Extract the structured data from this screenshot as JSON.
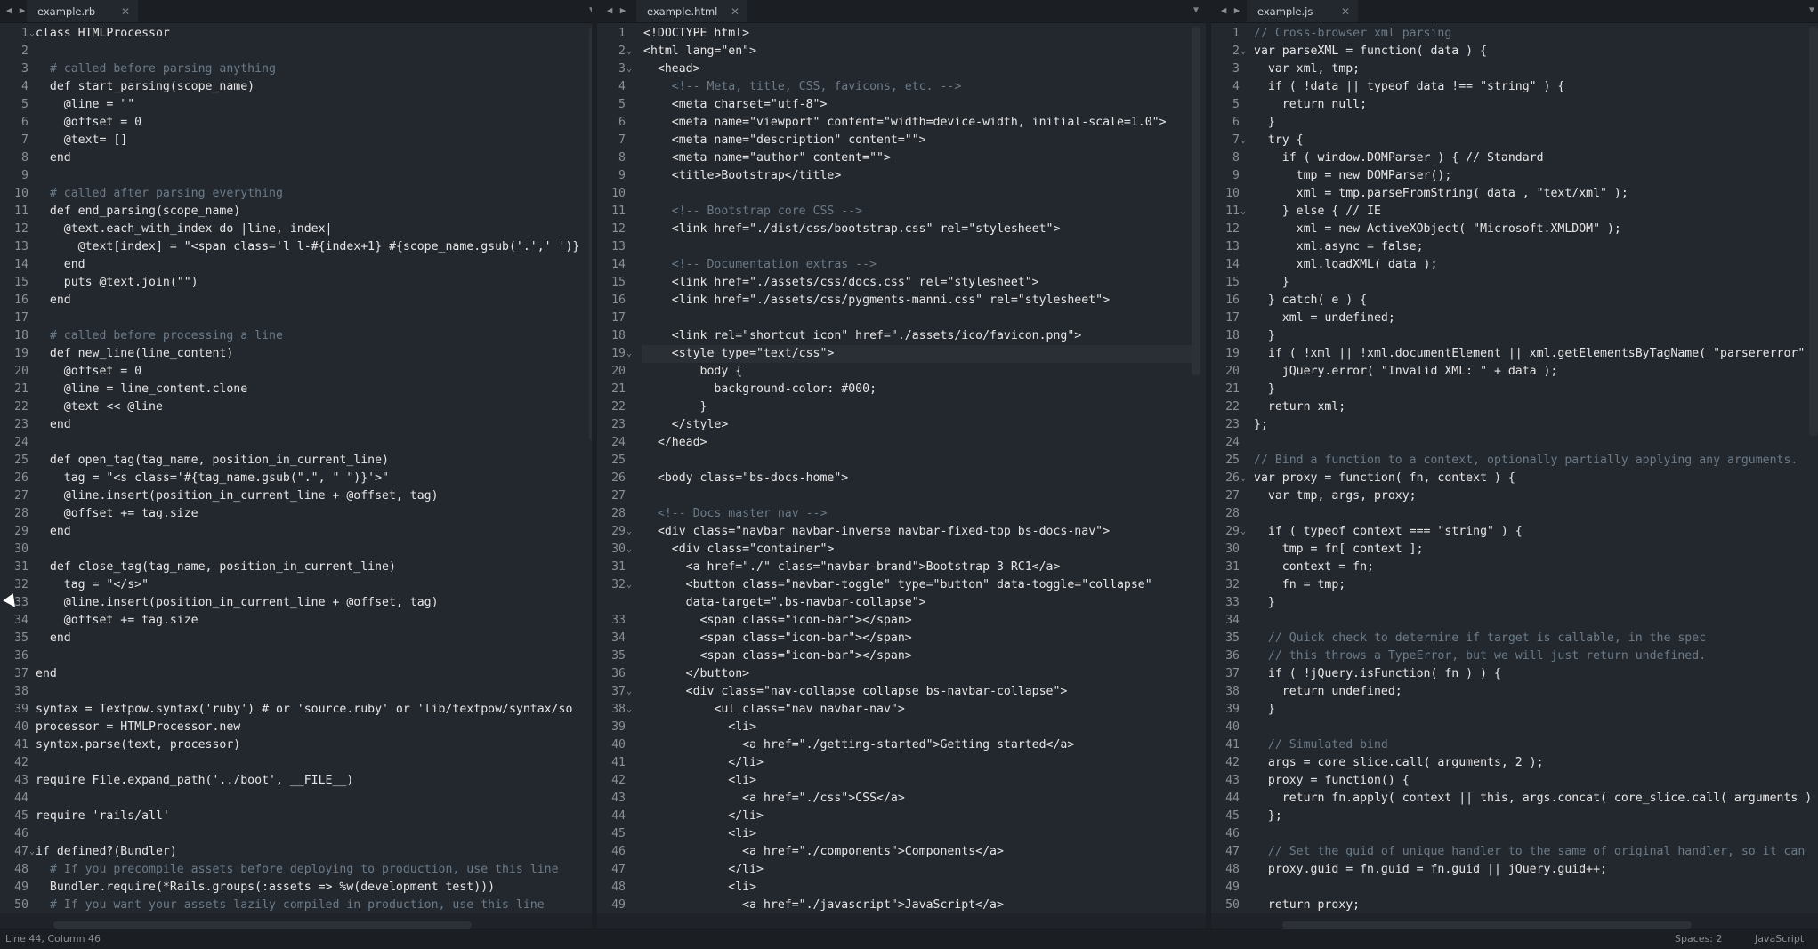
{
  "colors": {
    "bg": "#23272e",
    "accent": "#e27f60",
    "comment": "#6b7b88",
    "string": "#d8d8a8",
    "keyword": "#e27f60",
    "number": "#f2b06b",
    "attr": "#f7d089",
    "fn": "#7ec9d4"
  },
  "panes": [
    {
      "tab": "example.rb"
    },
    {
      "tab": "example.html"
    },
    {
      "tab": "example.js"
    }
  ],
  "status": {
    "position": "Line 44, Column 46",
    "indent": "Spaces: 2",
    "syntax": "JavaScript"
  },
  "pane1": {
    "lines": [
      "class HTMLProcessor",
      "",
      "  # called before parsing anything",
      "  def start_parsing(scope_name)",
      "    @line = \"\"",
      "    @offset = 0",
      "    @text= []",
      "  end",
      "",
      "  # called after parsing everything",
      "  def end_parsing(scope_name)",
      "    @text.each_with_index do |line, index|",
      "      @text[index] = \"<span class='l l-#{index+1} #{scope_name.gsub('.',' ')}",
      "    end",
      "    puts @text.join(\"\")",
      "  end",
      "",
      "  # called before processing a line",
      "  def new_line(line_content)",
      "    @offset = 0",
      "    @line = line_content.clone",
      "    @text << @line",
      "  end",
      "",
      "  def open_tag(tag_name, position_in_current_line)",
      "    tag = \"<s class='#{tag_name.gsub(\".\", \" \")}'>\"",
      "    @line.insert(position_in_current_line + @offset, tag)",
      "    @offset += tag.size",
      "  end",
      "",
      "  def close_tag(tag_name, position_in_current_line)",
      "    tag = \"</s>\"",
      "    @line.insert(position_in_current_line + @offset, tag)",
      "    @offset += tag.size",
      "  end",
      "",
      "end",
      "",
      "syntax = Textpow.syntax('ruby') # or 'source.ruby' or 'lib/textpow/syntax/so",
      "processor = HTMLProcessor.new",
      "syntax.parse(text, processor)",
      "",
      "require File.expand_path('../boot', __FILE__)",
      "",
      "require 'rails/all'",
      "",
      "if defined?(Bundler)",
      "  # If you precompile assets before deploying to production, use this line",
      "  Bundler.require(*Rails.groups(:assets => %w(development test)))",
      "  # If you want your assets lazily compiled in production, use this line"
    ],
    "folds": [
      1,
      47
    ]
  },
  "pane2": {
    "lines": [
      "<!DOCTYPE html>",
      "<html lang=\"en\">",
      "  <head>",
      "    <!-- Meta, title, CSS, favicons, etc. -->",
      "    <meta charset=\"utf-8\">",
      "    <meta name=\"viewport\" content=\"width=device-width, initial-scale=1.0\">",
      "    <meta name=\"description\" content=\"\">",
      "    <meta name=\"author\" content=\"\">",
      "    <title>Bootstrap</title>",
      "",
      "    <!-- Bootstrap core CSS -->",
      "    <link href=\"./dist/css/bootstrap.css\" rel=\"stylesheet\">",
      "",
      "    <!-- Documentation extras -->",
      "    <link href=\"./assets/css/docs.css\" rel=\"stylesheet\">",
      "    <link href=\"./assets/css/pygments-manni.css\" rel=\"stylesheet\">",
      "",
      "    <link rel=\"shortcut icon\" href=\"./assets/ico/favicon.png\">",
      "    <style type=\"text/css\">",
      "        body {",
      "          background-color: #000;",
      "        }",
      "    </style>",
      "  </head>",
      "",
      "  <body class=\"bs-docs-home\">",
      "",
      "  <!-- Docs master nav -->",
      "  <div class=\"navbar navbar-inverse navbar-fixed-top bs-docs-nav\">",
      "    <div class=\"container\">",
      "      <a href=\"./\" class=\"navbar-brand\">Bootstrap 3 RC1</a>",
      "      <button class=\"navbar-toggle\" type=\"button\" data-toggle=\"collapse\"",
      "      data-target=\".bs-navbar-collapse\">",
      "        <span class=\"icon-bar\"></span>",
      "        <span class=\"icon-bar\"></span>",
      "        <span class=\"icon-bar\"></span>",
      "      </button>",
      "      <div class=\"nav-collapse collapse bs-navbar-collapse\">",
      "          <ul class=\"nav navbar-nav\">",
      "            <li>",
      "              <a href=\"./getting-started\">Getting started</a>",
      "            </li>",
      "            <li>",
      "              <a href=\"./css\">CSS</a>",
      "            </li>",
      "            <li>",
      "              <a href=\"./components\">Components</a>",
      "            </li>",
      "            <li>",
      "              <a href=\"./javascript\">JavaScript</a>",
      "            </li>"
    ],
    "numbers": [
      "1",
      "2",
      "3",
      "4",
      "5",
      "6",
      "7",
      "8",
      "9",
      "10",
      "11",
      "12",
      "13",
      "14",
      "15",
      "16",
      "17",
      "18",
      "19",
      "20",
      "21",
      "22",
      "23",
      "24",
      "25",
      "26",
      "27",
      "28",
      "29",
      "30",
      "31",
      "32",
      "",
      "33",
      "34",
      "35",
      "36",
      "37",
      "38",
      "39",
      "40",
      "41",
      "42",
      "43",
      "44",
      "45",
      "46",
      "47",
      "48",
      "49",
      "50"
    ],
    "folds": [
      2,
      3,
      19,
      29,
      30,
      32,
      37,
      38
    ]
  },
  "pane3": {
    "lines": [
      "// Cross-browser xml parsing",
      "var parseXML = function( data ) {",
      "  var xml, tmp;",
      "  if ( !data || typeof data !== \"string\" ) {",
      "    return null;",
      "  }",
      "  try {",
      "    if ( window.DOMParser ) { // Standard",
      "      tmp = new DOMParser();",
      "      xml = tmp.parseFromString( data , \"text/xml\" );",
      "    } else { // IE",
      "      xml = new ActiveXObject( \"Microsoft.XMLDOM\" );",
      "      xml.async = false;",
      "      xml.loadXML( data );",
      "    }",
      "  } catch( e ) {",
      "    xml = undefined;",
      "  }",
      "  if ( !xml || !xml.documentElement || xml.getElementsByTagName( \"parsererror\"",
      "    jQuery.error( \"Invalid XML: \" + data );",
      "  }",
      "  return xml;",
      "};",
      "",
      "// Bind a function to a context, optionally partially applying any arguments.",
      "var proxy = function( fn, context ) {",
      "  var tmp, args, proxy;",
      "",
      "  if ( typeof context === \"string\" ) {",
      "    tmp = fn[ context ];",
      "    context = fn;",
      "    fn = tmp;",
      "  }",
      "",
      "  // Quick check to determine if target is callable, in the spec",
      "  // this throws a TypeError, but we will just return undefined.",
      "  if ( !jQuery.isFunction( fn ) ) {",
      "    return undefined;",
      "  }",
      "",
      "  // Simulated bind",
      "  args = core_slice.call( arguments, 2 );",
      "  proxy = function() {",
      "    return fn.apply( context || this, args.concat( core_slice.call( arguments ) ",
      "  };",
      "",
      "  // Set the guid of unique handler to the same of original handler, so it can",
      "  proxy.guid = fn.guid = fn.guid || jQuery.guid++;",
      "",
      "  return proxy;"
    ],
    "folds": [
      2,
      7,
      11,
      26,
      29
    ]
  }
}
